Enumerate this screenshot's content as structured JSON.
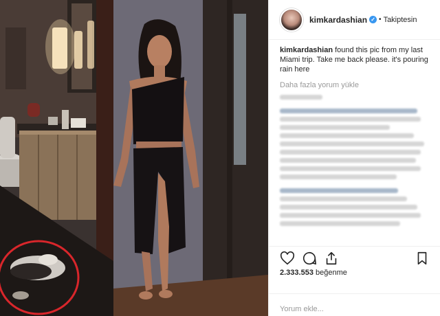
{
  "post": {
    "username": "kimkardashian",
    "verified_icon": "verified-badge-icon",
    "separator": "•",
    "follow_status": "Takiptesin"
  },
  "caption": {
    "author": "kimkardashian",
    "text": " found this pic from my last Miami trip. Take me back please. it's pouring rain here"
  },
  "load_more_label": "Daha fazla yorum yükle",
  "actions": {
    "like": "heart-icon",
    "comment": "comment-icon",
    "share": "share-icon",
    "save": "bookmark-icon"
  },
  "likes": {
    "count": "2.333.553",
    "suffix": " beğenme"
  },
  "comment_input": {
    "placeholder": "Yorum ekle..."
  },
  "colors": {
    "highlight_circle": "#d9262b",
    "verified": "#3897f0",
    "muted_text": "#999999"
  }
}
